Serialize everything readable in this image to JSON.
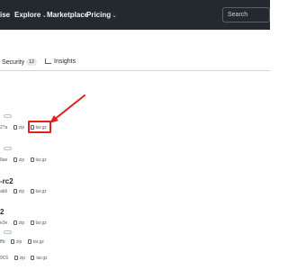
{
  "header": {
    "nav": [
      "ise",
      "Explore",
      "Marketplace",
      "Pricing"
    ],
    "search_placeholder": "Search"
  },
  "tabs": {
    "security_label": "Security",
    "security_count": "12",
    "insights_label": "Insights"
  },
  "releases": [
    {
      "tag": "",
      "sha": "2?a",
      "zip": "zip",
      "tar": "tar.gz"
    },
    {
      "tag": "",
      "sha": "8ae",
      "zip": "zip",
      "tar": "tar.gz"
    },
    {
      "tag": "-rc2",
      "sha": "ab6",
      "zip": "zip",
      "tar": "tar.gz"
    },
    {
      "tag": "2",
      "sha": "e3e",
      "zip": "zip",
      "tar": "tar.gz"
    },
    {
      "tag": "",
      "sha": "ffb",
      "zip": "zip",
      "tar": "tar.gz"
    },
    {
      "tag": "",
      "sha": "9C6",
      "zip": "zip",
      "tar": "tar.gz"
    }
  ],
  "colors": {
    "header_bg": "#24292f",
    "link": "#0969da",
    "annotation": "#e0211d"
  }
}
